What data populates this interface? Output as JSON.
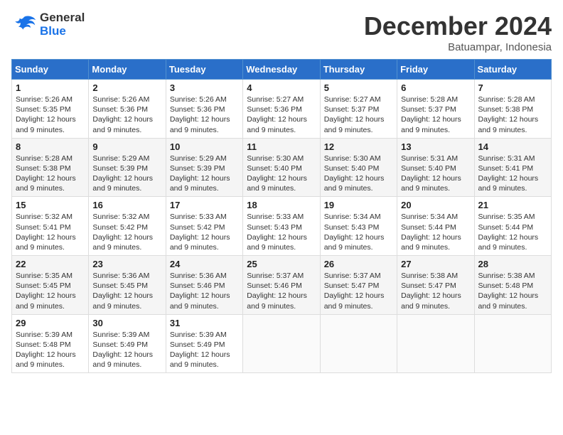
{
  "header": {
    "logo_text_general": "General",
    "logo_text_blue": "Blue",
    "month_title": "December 2024",
    "location": "Batuampar, Indonesia"
  },
  "weekdays": [
    "Sunday",
    "Monday",
    "Tuesday",
    "Wednesday",
    "Thursday",
    "Friday",
    "Saturday"
  ],
  "weeks": [
    [
      {
        "day": "1",
        "sunrise": "5:26 AM",
        "sunset": "5:35 PM",
        "daylight": "12 hours and 9 minutes."
      },
      {
        "day": "2",
        "sunrise": "5:26 AM",
        "sunset": "5:36 PM",
        "daylight": "12 hours and 9 minutes."
      },
      {
        "day": "3",
        "sunrise": "5:26 AM",
        "sunset": "5:36 PM",
        "daylight": "12 hours and 9 minutes."
      },
      {
        "day": "4",
        "sunrise": "5:27 AM",
        "sunset": "5:36 PM",
        "daylight": "12 hours and 9 minutes."
      },
      {
        "day": "5",
        "sunrise": "5:27 AM",
        "sunset": "5:37 PM",
        "daylight": "12 hours and 9 minutes."
      },
      {
        "day": "6",
        "sunrise": "5:28 AM",
        "sunset": "5:37 PM",
        "daylight": "12 hours and 9 minutes."
      },
      {
        "day": "7",
        "sunrise": "5:28 AM",
        "sunset": "5:38 PM",
        "daylight": "12 hours and 9 minutes."
      }
    ],
    [
      {
        "day": "8",
        "sunrise": "5:28 AM",
        "sunset": "5:38 PM",
        "daylight": "12 hours and 9 minutes."
      },
      {
        "day": "9",
        "sunrise": "5:29 AM",
        "sunset": "5:39 PM",
        "daylight": "12 hours and 9 minutes."
      },
      {
        "day": "10",
        "sunrise": "5:29 AM",
        "sunset": "5:39 PM",
        "daylight": "12 hours and 9 minutes."
      },
      {
        "day": "11",
        "sunrise": "5:30 AM",
        "sunset": "5:40 PM",
        "daylight": "12 hours and 9 minutes."
      },
      {
        "day": "12",
        "sunrise": "5:30 AM",
        "sunset": "5:40 PM",
        "daylight": "12 hours and 9 minutes."
      },
      {
        "day": "13",
        "sunrise": "5:31 AM",
        "sunset": "5:40 PM",
        "daylight": "12 hours and 9 minutes."
      },
      {
        "day": "14",
        "sunrise": "5:31 AM",
        "sunset": "5:41 PM",
        "daylight": "12 hours and 9 minutes."
      }
    ],
    [
      {
        "day": "15",
        "sunrise": "5:32 AM",
        "sunset": "5:41 PM",
        "daylight": "12 hours and 9 minutes."
      },
      {
        "day": "16",
        "sunrise": "5:32 AM",
        "sunset": "5:42 PM",
        "daylight": "12 hours and 9 minutes."
      },
      {
        "day": "17",
        "sunrise": "5:33 AM",
        "sunset": "5:42 PM",
        "daylight": "12 hours and 9 minutes."
      },
      {
        "day": "18",
        "sunrise": "5:33 AM",
        "sunset": "5:43 PM",
        "daylight": "12 hours and 9 minutes."
      },
      {
        "day": "19",
        "sunrise": "5:34 AM",
        "sunset": "5:43 PM",
        "daylight": "12 hours and 9 minutes."
      },
      {
        "day": "20",
        "sunrise": "5:34 AM",
        "sunset": "5:44 PM",
        "daylight": "12 hours and 9 minutes."
      },
      {
        "day": "21",
        "sunrise": "5:35 AM",
        "sunset": "5:44 PM",
        "daylight": "12 hours and 9 minutes."
      }
    ],
    [
      {
        "day": "22",
        "sunrise": "5:35 AM",
        "sunset": "5:45 PM",
        "daylight": "12 hours and 9 minutes."
      },
      {
        "day": "23",
        "sunrise": "5:36 AM",
        "sunset": "5:45 PM",
        "daylight": "12 hours and 9 minutes."
      },
      {
        "day": "24",
        "sunrise": "5:36 AM",
        "sunset": "5:46 PM",
        "daylight": "12 hours and 9 minutes."
      },
      {
        "day": "25",
        "sunrise": "5:37 AM",
        "sunset": "5:46 PM",
        "daylight": "12 hours and 9 minutes."
      },
      {
        "day": "26",
        "sunrise": "5:37 AM",
        "sunset": "5:47 PM",
        "daylight": "12 hours and 9 minutes."
      },
      {
        "day": "27",
        "sunrise": "5:38 AM",
        "sunset": "5:47 PM",
        "daylight": "12 hours and 9 minutes."
      },
      {
        "day": "28",
        "sunrise": "5:38 AM",
        "sunset": "5:48 PM",
        "daylight": "12 hours and 9 minutes."
      }
    ],
    [
      {
        "day": "29",
        "sunrise": "5:39 AM",
        "sunset": "5:48 PM",
        "daylight": "12 hours and 9 minutes."
      },
      {
        "day": "30",
        "sunrise": "5:39 AM",
        "sunset": "5:49 PM",
        "daylight": "12 hours and 9 minutes."
      },
      {
        "day": "31",
        "sunrise": "5:39 AM",
        "sunset": "5:49 PM",
        "daylight": "12 hours and 9 minutes."
      },
      null,
      null,
      null,
      null
    ]
  ]
}
